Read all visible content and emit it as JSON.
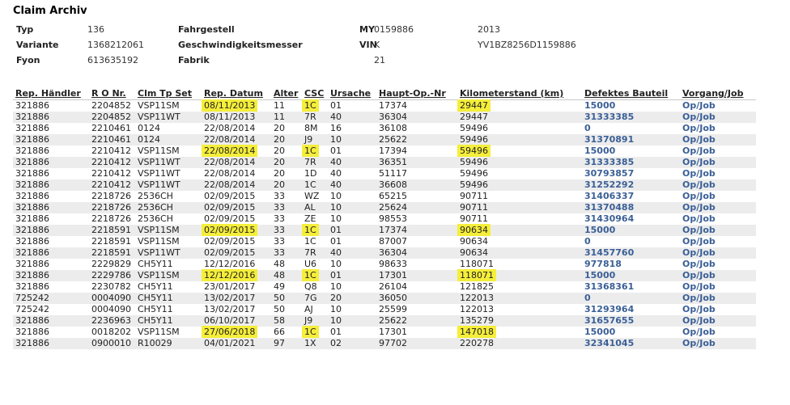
{
  "page": {
    "title": "Claim Archiv"
  },
  "info": {
    "rows": [
      [
        {
          "label": "Typ",
          "value": "136"
        },
        {
          "label": "Fahrgestell",
          "value": "0159886"
        },
        {
          "label": "MY",
          "value": "2013"
        }
      ],
      [
        {
          "label": "Variante",
          "value": "1368212061"
        },
        {
          "label": "Geschwindigkeitsmesser",
          "value": "K"
        },
        {
          "label": "VIN",
          "value": "YV1BZ8256D1159886"
        }
      ],
      [
        {
          "label": "Fyon",
          "value": "613635192"
        },
        {
          "label": "Fabrik",
          "value": "21"
        },
        {
          "label": "",
          "value": ""
        }
      ]
    ]
  },
  "table": {
    "headers": [
      "Rep. Händler",
      "R O Nr.",
      "Clm Tp Set",
      "Rep. Datum",
      "Alter",
      "CSC",
      "Ursache",
      "Haupt-Op.-Nr",
      "Kilometerstand (km)",
      "Defektes Bauteil",
      "Vorgang/Job"
    ],
    "highlight_color": "#f5ee3a",
    "link_color": "#3a5f96",
    "rows": [
      {
        "dealer": "321886",
        "ro": "2204852",
        "clm": "VSP11SM",
        "date": "08/11/2013",
        "age": "11",
        "csc": "1C",
        "cause": "01",
        "op": "17374",
        "km": "29447",
        "part": "15000",
        "job": "Op/Job",
        "hl": true
      },
      {
        "dealer": "321886",
        "ro": "2204852",
        "clm": "VSP11WT",
        "date": "08/11/2013",
        "age": "11",
        "csc": "7R",
        "cause": "40",
        "op": "36304",
        "km": "29447",
        "part": "31333385",
        "job": "Op/Job",
        "hl": false
      },
      {
        "dealer": "321886",
        "ro": "2210461",
        "clm": "0124",
        "date": "22/08/2014",
        "age": "20",
        "csc": "8M",
        "cause": "16",
        "op": "36108",
        "km": "59496",
        "part": "0",
        "job": "Op/Job",
        "hl": false
      },
      {
        "dealer": "321886",
        "ro": "2210461",
        "clm": "0124",
        "date": "22/08/2014",
        "age": "20",
        "csc": "J9",
        "cause": "10",
        "op": "25622",
        "km": "59496",
        "part": "31370891",
        "job": "Op/Job",
        "hl": false
      },
      {
        "dealer": "321886",
        "ro": "2210412",
        "clm": "VSP11SM",
        "date": "22/08/2014",
        "age": "20",
        "csc": "1C",
        "cause": "01",
        "op": "17394",
        "km": "59496",
        "part": "15000",
        "job": "Op/Job",
        "hl": true
      },
      {
        "dealer": "321886",
        "ro": "2210412",
        "clm": "VSP11WT",
        "date": "22/08/2014",
        "age": "20",
        "csc": "7R",
        "cause": "40",
        "op": "36351",
        "km": "59496",
        "part": "31333385",
        "job": "Op/Job",
        "hl": false
      },
      {
        "dealer": "321886",
        "ro": "2210412",
        "clm": "VSP11WT",
        "date": "22/08/2014",
        "age": "20",
        "csc": "1D",
        "cause": "40",
        "op": "51117",
        "km": "59496",
        "part": "30793857",
        "job": "Op/Job",
        "hl": false
      },
      {
        "dealer": "321886",
        "ro": "2210412",
        "clm": "VSP11WT",
        "date": "22/08/2014",
        "age": "20",
        "csc": "1C",
        "cause": "40",
        "op": "36608",
        "km": "59496",
        "part": "31252292",
        "job": "Op/Job",
        "hl": false
      },
      {
        "dealer": "321886",
        "ro": "2218726",
        "clm": "2536CH",
        "date": "02/09/2015",
        "age": "33",
        "csc": "WZ",
        "cause": "10",
        "op": "65215",
        "km": "90711",
        "part": "31406337",
        "job": "Op/Job",
        "hl": false
      },
      {
        "dealer": "321886",
        "ro": "2218726",
        "clm": "2536CH",
        "date": "02/09/2015",
        "age": "33",
        "csc": "AL",
        "cause": "10",
        "op": "25624",
        "km": "90711",
        "part": "31370488",
        "job": "Op/Job",
        "hl": false
      },
      {
        "dealer": "321886",
        "ro": "2218726",
        "clm": "2536CH",
        "date": "02/09/2015",
        "age": "33",
        "csc": "ZE",
        "cause": "10",
        "op": "98553",
        "km": "90711",
        "part": "31430964",
        "job": "Op/Job",
        "hl": false
      },
      {
        "dealer": "321886",
        "ro": "2218591",
        "clm": "VSP11SM",
        "date": "02/09/2015",
        "age": "33",
        "csc": "1C",
        "cause": "01",
        "op": "17374",
        "km": "90634",
        "part": "15000",
        "job": "Op/Job",
        "hl": true
      },
      {
        "dealer": "321886",
        "ro": "2218591",
        "clm": "VSP11SM",
        "date": "02/09/2015",
        "age": "33",
        "csc": "1C",
        "cause": "01",
        "op": "87007",
        "km": "90634",
        "part": "0",
        "job": "Op/Job",
        "hl": false
      },
      {
        "dealer": "321886",
        "ro": "2218591",
        "clm": "VSP11WT",
        "date": "02/09/2015",
        "age": "33",
        "csc": "7R",
        "cause": "40",
        "op": "36304",
        "km": "90634",
        "part": "31457760",
        "job": "Op/Job",
        "hl": false
      },
      {
        "dealer": "321886",
        "ro": "2229829",
        "clm": "CH5Y11",
        "date": "12/12/2016",
        "age": "48",
        "csc": "U6",
        "cause": "10",
        "op": "98633",
        "km": "118071",
        "part": "977818",
        "job": "Op/Job",
        "hl": false
      },
      {
        "dealer": "321886",
        "ro": "2229786",
        "clm": "VSP11SM",
        "date": "12/12/2016",
        "age": "48",
        "csc": "1C",
        "cause": "01",
        "op": "17301",
        "km": "118071",
        "part": "15000",
        "job": "Op/Job",
        "hl": true
      },
      {
        "dealer": "321886",
        "ro": "2230782",
        "clm": "CH5Y11",
        "date": "23/01/2017",
        "age": "49",
        "csc": "Q8",
        "cause": "10",
        "op": "26104",
        "km": "121825",
        "part": "31368361",
        "job": "Op/Job",
        "hl": false
      },
      {
        "dealer": "725242",
        "ro": "0004090",
        "clm": "CH5Y11",
        "date": "13/02/2017",
        "age": "50",
        "csc": "7G",
        "cause": "20",
        "op": "36050",
        "km": "122013",
        "part": "0",
        "job": "Op/Job",
        "hl": false
      },
      {
        "dealer": "725242",
        "ro": "0004090",
        "clm": "CH5Y11",
        "date": "13/02/2017",
        "age": "50",
        "csc": "AJ",
        "cause": "10",
        "op": "25599",
        "km": "122013",
        "part": "31293964",
        "job": "Op/Job",
        "hl": false
      },
      {
        "dealer": "321886",
        "ro": "2236963",
        "clm": "CH5Y11",
        "date": "06/10/2017",
        "age": "58",
        "csc": "J9",
        "cause": "10",
        "op": "25622",
        "km": "135279",
        "part": "31657655",
        "job": "Op/Job",
        "hl": false
      },
      {
        "dealer": "321886",
        "ro": "0018202",
        "clm": "VSP11SM",
        "date": "27/06/2018",
        "age": "66",
        "csc": "1C",
        "cause": "01",
        "op": "17301",
        "km": "147018",
        "part": "15000",
        "job": "Op/Job",
        "hl": true
      },
      {
        "dealer": "321886",
        "ro": "0900010",
        "clm": "R10029",
        "date": "04/01/2021",
        "age": "97",
        "csc": "1X",
        "cause": "02",
        "op": "97702",
        "km": "220278",
        "part": "32341045",
        "job": "Op/Job",
        "hl": false
      }
    ]
  }
}
